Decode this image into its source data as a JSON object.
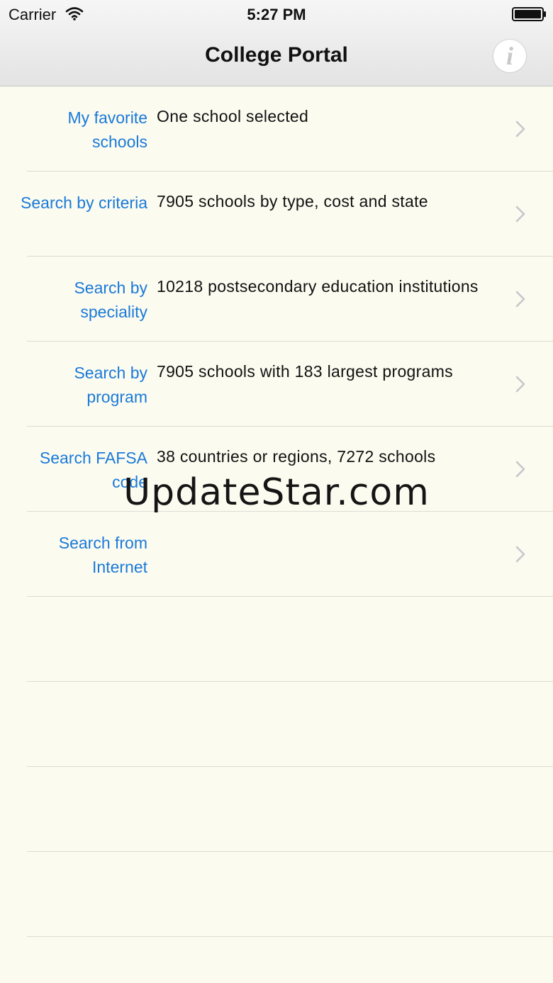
{
  "status_bar": {
    "carrier": "Carrier",
    "time": "5:27 PM",
    "wifi_icon": "wifi-icon",
    "battery_icon": "battery-icon"
  },
  "nav": {
    "title": "College Portal",
    "info_icon": "info-icon",
    "info_glyph": "i"
  },
  "list": {
    "rows": [
      {
        "label": "My favorite schools",
        "detail": "One school selected"
      },
      {
        "label": "Search by criteria",
        "detail": "7905 schools by type, cost and state"
      },
      {
        "label": "Search by speciality",
        "detail": "10218 postsecondary education institutions"
      },
      {
        "label": "Search by program",
        "detail": "7905 schools with 183 largest programs"
      },
      {
        "label": "Search FAFSA code",
        "detail": "38 countries or regions, 7272 schools"
      },
      {
        "label": "Search from Internet",
        "detail": ""
      }
    ],
    "chevron_icon": "chevron-right-icon"
  },
  "watermark": "UpdateStar.com",
  "colors": {
    "background": "#fcfbf0",
    "label": "#1a7ad8",
    "separator": "#dcdcd4",
    "chevron": "#c7c7cc"
  }
}
